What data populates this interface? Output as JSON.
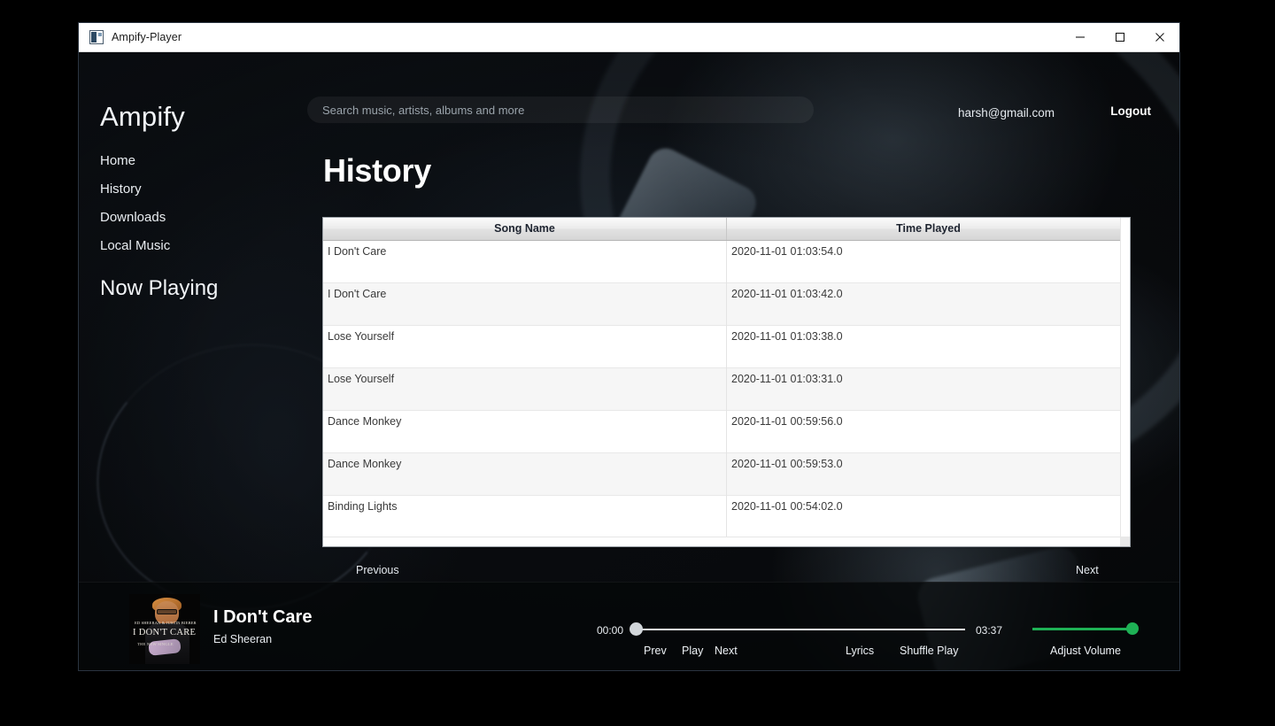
{
  "window": {
    "title": "Ampify-Player",
    "app_icon": "app-icon",
    "controls": {
      "minimize": "minimize-icon",
      "maximize": "maximize-icon",
      "close": "close-icon"
    }
  },
  "header": {
    "search_placeholder": "Search music, artists, albums and more",
    "search_value": "",
    "user_email": "harsh@gmail.com",
    "logout_label": "Logout"
  },
  "sidebar": {
    "brand": "Ampify",
    "items": [
      {
        "label": "Home"
      },
      {
        "label": "History"
      },
      {
        "label": "Downloads"
      },
      {
        "label": "Local Music"
      }
    ],
    "now_playing_heading": "Now Playing"
  },
  "main": {
    "page_title": "History",
    "table": {
      "columns": [
        "Song Name",
        "Time Played"
      ],
      "rows": [
        {
          "song": "I Don't Care",
          "time": "2020-11-01 01:03:54.0"
        },
        {
          "song": "I Don't Care",
          "time": "2020-11-01 01:03:42.0"
        },
        {
          "song": "Lose Yourself",
          "time": "2020-11-01 01:03:38.0"
        },
        {
          "song": "Lose Yourself",
          "time": "2020-11-01 01:03:31.0"
        },
        {
          "song": "Dance Monkey",
          "time": "2020-11-01 00:59:56.0"
        },
        {
          "song": "Dance Monkey",
          "time": "2020-11-01 00:59:53.0"
        },
        {
          "song": "Binding Lights",
          "time": "2020-11-01 00:54:02.0"
        }
      ]
    },
    "pagination": {
      "previous_label": "Previous",
      "next_label": "Next"
    }
  },
  "player": {
    "album_art": {
      "line1": "ED SHEERAN & JUSTIN BIEBER",
      "line2": "I DON'T CARE",
      "line3": "THE NEW SINGLE"
    },
    "track_title": "I Don't Care",
    "track_artist": "Ed Sheeran",
    "time_current": "00:00",
    "time_total": "03:37",
    "progress_percent": 0,
    "controls": {
      "prev": "Prev",
      "play": "Play",
      "next": "Next",
      "lyrics": "Lyrics",
      "shuffle": "Shuffle Play"
    },
    "volume": {
      "label": "Adjust Volume",
      "level_percent": 100,
      "color": "#1eb155"
    }
  }
}
